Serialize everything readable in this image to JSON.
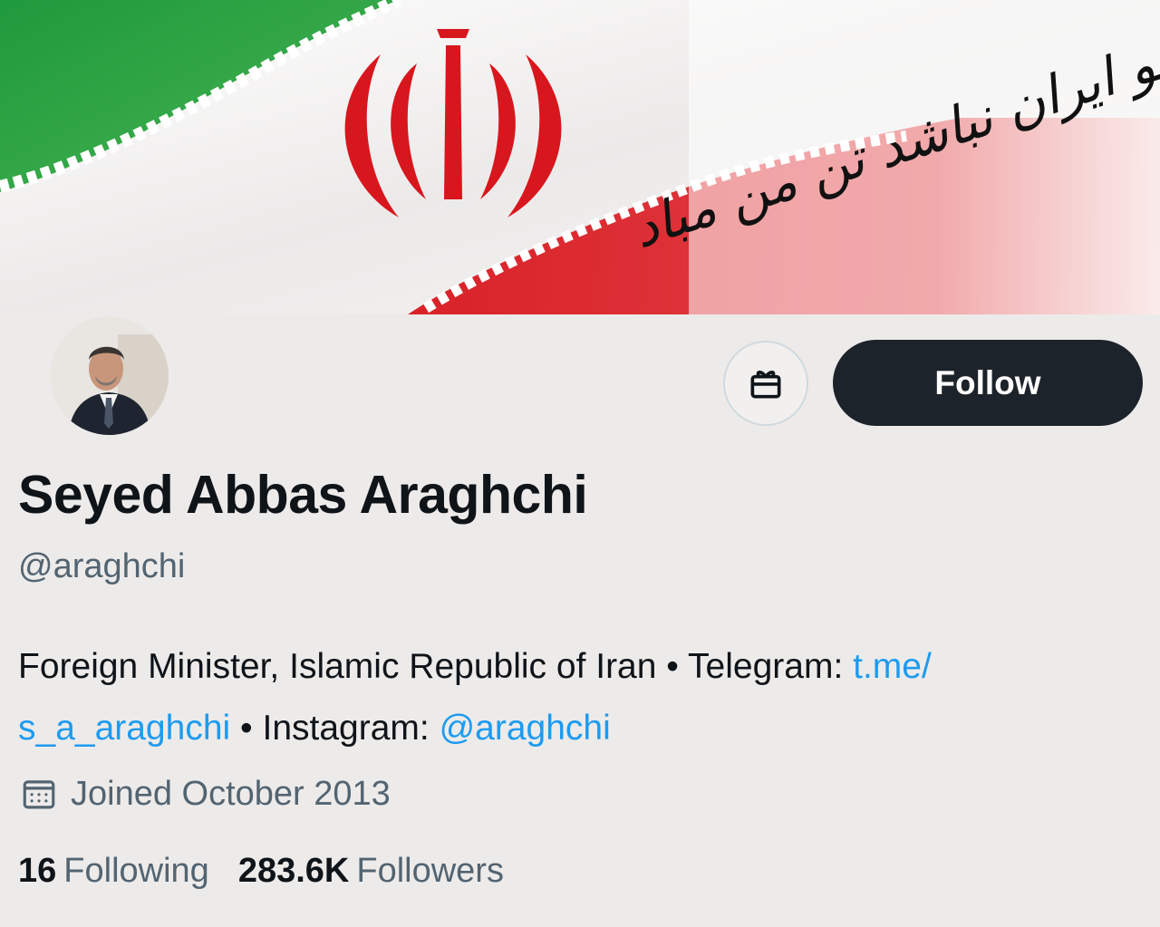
{
  "banner": {
    "calligraphy": "چو ایران نباشد تن من مباد",
    "colors": {
      "green": "#239f40",
      "white": "#ffffff",
      "red": "#da0000"
    }
  },
  "profile": {
    "display_name": "Seyed Abbas Araghchi",
    "handle": "@araghchi",
    "bio": {
      "line1_text": "Foreign Minister, Islamic Republic of Iran • Telegram: ",
      "line1_link": "t.me/",
      "line2_link": "s_a_araghchi",
      "line2_text": " • Instagram: ",
      "line2_link2": "@araghchi"
    },
    "joined": "Joined October 2013",
    "following_count": "16",
    "following_label": "Following",
    "followers_count": "283.6K",
    "followers_label": "Followers"
  },
  "actions": {
    "follow_label": "Follow",
    "gift_icon": "gift-icon"
  },
  "colors": {
    "link": "#1d9bf0",
    "button_bg": "#1d232a",
    "secondary_text": "#536471"
  }
}
